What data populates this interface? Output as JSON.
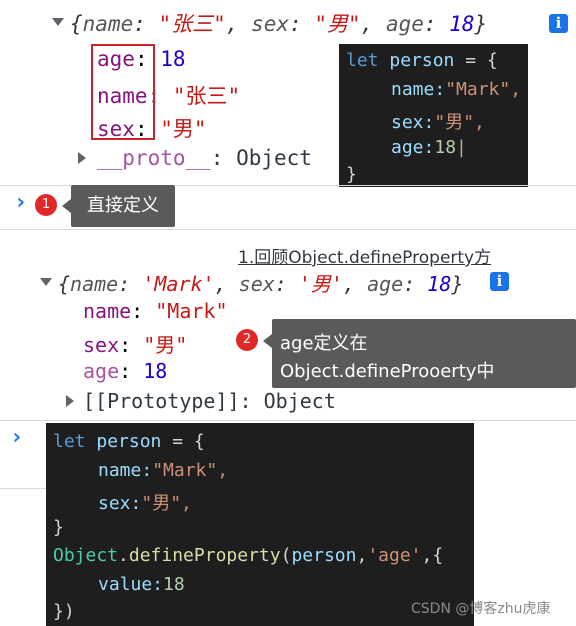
{
  "panel1": {
    "summary": {
      "open": "{",
      "k1": "name",
      "v1": "\"张三\"",
      "k2": "sex",
      "v2": "\"男\"",
      "k3": "age",
      "v3": "18",
      "close": "}",
      "sep1": ": ",
      "sep2": ", "
    },
    "props": [
      {
        "key": "age",
        "sep": ": ",
        "value": "18"
      },
      {
        "key": "name",
        "sep": ": ",
        "value": "\"张三\""
      },
      {
        "key": "sex",
        "sep": ": ",
        "value": "\"男\""
      }
    ],
    "proto": {
      "key": "__proto__",
      "value": "Object"
    },
    "code": {
      "l1_kw": "let",
      "l1_var": "person",
      "l1_rest": " = {",
      "l2_key": "name:",
      "l2_val": "\"Mark\",",
      "l3_key": "sex:",
      "l3_val": "\"男\",",
      "l4_key": "age:",
      "l4_val": "18",
      "l5": "}"
    },
    "callout": {
      "badge": "1",
      "text": "直接定义"
    },
    "info_icon": "i"
  },
  "panel2": {
    "source_link": "1.回顾Object.defineProperty方",
    "summary": {
      "open": "{",
      "k1": "name",
      "v1": "'Mark'",
      "k2": "sex",
      "v2": "'男'",
      "k3": "age",
      "v3": "18",
      "close": "}",
      "sep1": ": ",
      "sep2": ", "
    },
    "props": [
      {
        "key": "name",
        "sep": ": ",
        "value": "\"Mark\""
      },
      {
        "key": "sex",
        "sep": ": ",
        "value": "\"男\""
      },
      {
        "key": "age",
        "sep": ": ",
        "value": "18"
      }
    ],
    "proto": {
      "key": "[[Prototype]]",
      "value": "Object"
    },
    "callout": {
      "badge": "2",
      "line1": "age定义在",
      "line2": "Object.defineProoerty中"
    },
    "code": {
      "l1_kw": "let",
      "l1_var": "person",
      "l1_rest": " = {",
      "l2_key": "name:",
      "l2_val": "\"Mark\",",
      "l3_key": "sex:",
      "l3_val": "\"男\",",
      "l4": "}",
      "l5_cls": "Object",
      "l5_dot": ".",
      "l5_fn": "defineProperty",
      "l5_args1": "(",
      "l5_var": "person",
      "l5_comma": ",",
      "l5_str": "'age'",
      "l5_rest": ",{",
      "l6_key": "value:",
      "l6_val": "18",
      "l7": "})"
    },
    "info_icon": "i"
  },
  "watermark": "CSDN @博客zhu虎康",
  "colors": {
    "key_purple": "#881280",
    "string_red": "#c41a16",
    "number_blue": "#1c00cf",
    "badge_red": "#e12828",
    "box_red": "#c8242b",
    "console_blue": "#1a73e8"
  }
}
